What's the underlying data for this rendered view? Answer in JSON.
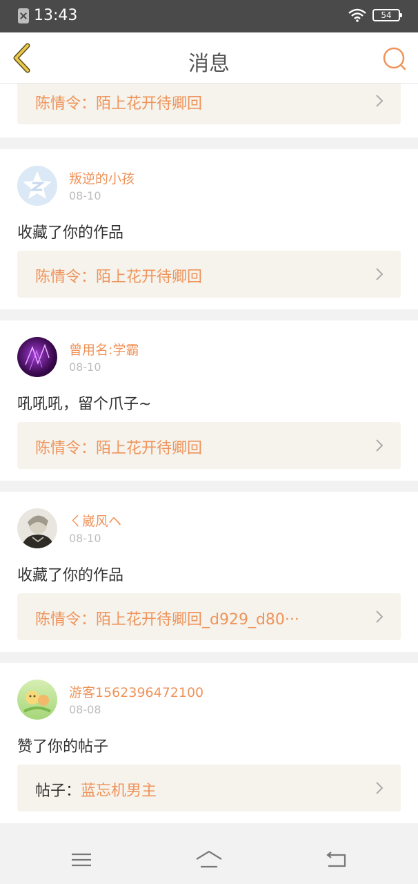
{
  "status_bar": {
    "time": "13:43",
    "battery": "54",
    "icons": [
      "sim-off-icon",
      "wifi-icon",
      "battery-icon"
    ]
  },
  "header": {
    "title": "消息",
    "back_icon": "chevron-left-icon",
    "search_icon": "search-icon"
  },
  "colors": {
    "accent": "#ef935a",
    "back_arrow": "#e8c84b",
    "link_bg": "#f5f3ec",
    "status_bar": "#4a4a4a"
  },
  "messages": [
    {
      "link_prefix": "",
      "link_text": "陈情令：陌上花开待卿回"
    },
    {
      "username": "叛逆的小孩",
      "date": "08-10",
      "action": "收藏了你的作品",
      "link_prefix": "",
      "link_text": "陈情令：陌上花开待卿回",
      "avatar": "qzone-avatar"
    },
    {
      "username": "曾用名:学霸",
      "date": "08-10",
      "action": "吼吼吼，留个爪子~",
      "link_prefix": "",
      "link_text": "陈情令：陌上花开待卿回",
      "avatar": "purple-art-avatar"
    },
    {
      "username": "ㄑ崴风ヘ",
      "date": "08-10",
      "action": "收藏了你的作品",
      "link_prefix": "",
      "link_text": "陈情令：陌上花开待卿回_d929_d80···",
      "avatar": "anime-boy-avatar"
    },
    {
      "username": "游客1562396472100",
      "date": "08-08",
      "action": "赞了你的帖子",
      "link_prefix": "帖子：",
      "link_text": "蓝忘机男主",
      "avatar": "cartoon-avatar"
    }
  ],
  "bottom_nav": [
    "menu-icon",
    "home-icon",
    "back-icon"
  ]
}
